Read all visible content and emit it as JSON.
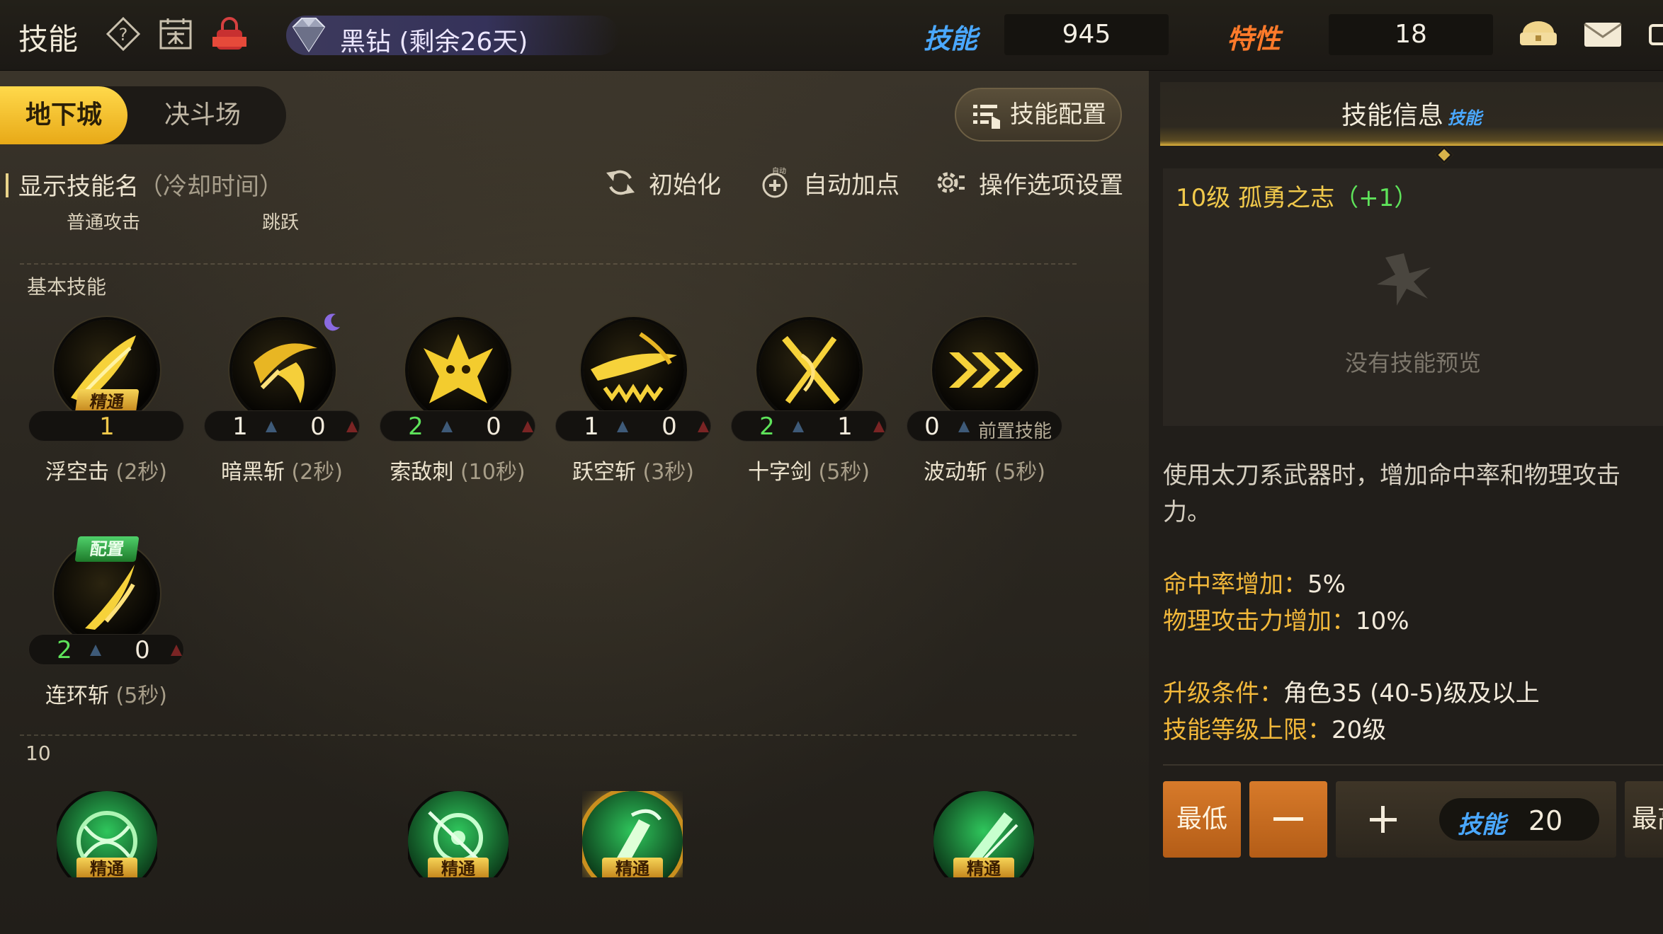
{
  "topbar": {
    "title": "技能",
    "diamond_text": "黑钻 (剩余26天)",
    "skill_label": "技能",
    "skill_points": "945",
    "trait_label": "特性",
    "trait_points": "18",
    "colors": {
      "skill_label": "#4aa8ff",
      "trait_label": "#ff7a2a"
    }
  },
  "tabs": {
    "dungeon": "地下城",
    "arena": "决斗场"
  },
  "toolbar": {
    "skill_config": "技能配置",
    "show_names": "显示技能名",
    "show_names_paren": "（冷却时间）",
    "reset": "初始化",
    "auto_add": "自动加点",
    "auto_tag": "自动",
    "options": "操作选项设置"
  },
  "basic_labels": {
    "normal_attack": "普通攻击",
    "jump": "跳跃"
  },
  "section_basic": "基本技能",
  "skills": [
    {
      "name": "浮空击",
      "cd": "(2秒)",
      "badge": "精通",
      "level": "1"
    },
    {
      "name": "暗黑斩",
      "cd": "(2秒)",
      "a": "1",
      "b": "0"
    },
    {
      "name": "索敌刺",
      "cd": "(10秒)",
      "a": "2",
      "b": "0"
    },
    {
      "name": "跃空斩",
      "cd": "(3秒)",
      "a": "1",
      "b": "0"
    },
    {
      "name": "十字剑",
      "cd": "(5秒)",
      "a": "2",
      "b": "1"
    },
    {
      "name": "波动斩",
      "cd": "(5秒)",
      "a": "0",
      "prereq": "前置技能"
    },
    {
      "name": "连环斩",
      "cd": "(5秒)",
      "badge": "配置",
      "a": "2",
      "b": "0"
    }
  ],
  "tier_label": "10",
  "bottom_badges": [
    "精通",
    "精通",
    "精通",
    "精通"
  ],
  "info": {
    "header": "技能信息",
    "header_tag": "技能",
    "preview_title": "10级 孤勇之志",
    "preview_plus": "（+1）",
    "no_preview": "没有技能预览",
    "description": "使用太刀系武器时，增加命中率和物理攻击力。",
    "stats": [
      {
        "k": "命中率增加：",
        "v": "5%"
      },
      {
        "k": "物理攻击力增加：",
        "v": "10%"
      },
      {
        "k": "升级条件：",
        "v": "角色35 (40-5)级及以上"
      },
      {
        "k": "技能等级上限：",
        "v": "20级"
      }
    ],
    "btn_min": "最低",
    "counter_tag": "技能",
    "counter_value": "20",
    "btn_max": "最高"
  }
}
